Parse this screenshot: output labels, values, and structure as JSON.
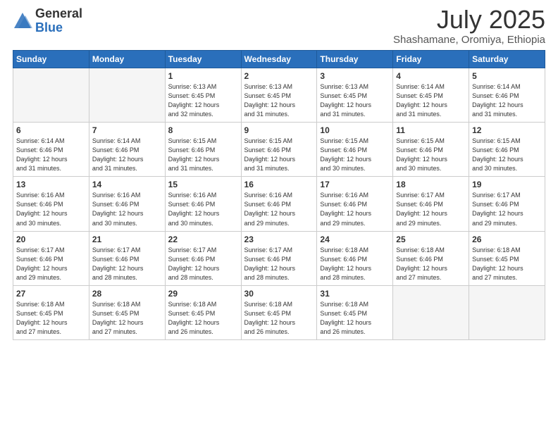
{
  "logo": {
    "general": "General",
    "blue": "Blue"
  },
  "title": {
    "month": "July 2025",
    "location": "Shashamane, Oromiya, Ethiopia"
  },
  "weekdays": [
    "Sunday",
    "Monday",
    "Tuesday",
    "Wednesday",
    "Thursday",
    "Friday",
    "Saturday"
  ],
  "weeks": [
    [
      {
        "day": "",
        "info": ""
      },
      {
        "day": "",
        "info": ""
      },
      {
        "day": "1",
        "info": "Sunrise: 6:13 AM\nSunset: 6:45 PM\nDaylight: 12 hours\nand 32 minutes."
      },
      {
        "day": "2",
        "info": "Sunrise: 6:13 AM\nSunset: 6:45 PM\nDaylight: 12 hours\nand 31 minutes."
      },
      {
        "day": "3",
        "info": "Sunrise: 6:13 AM\nSunset: 6:45 PM\nDaylight: 12 hours\nand 31 minutes."
      },
      {
        "day": "4",
        "info": "Sunrise: 6:14 AM\nSunset: 6:45 PM\nDaylight: 12 hours\nand 31 minutes."
      },
      {
        "day": "5",
        "info": "Sunrise: 6:14 AM\nSunset: 6:46 PM\nDaylight: 12 hours\nand 31 minutes."
      }
    ],
    [
      {
        "day": "6",
        "info": "Sunrise: 6:14 AM\nSunset: 6:46 PM\nDaylight: 12 hours\nand 31 minutes."
      },
      {
        "day": "7",
        "info": "Sunrise: 6:14 AM\nSunset: 6:46 PM\nDaylight: 12 hours\nand 31 minutes."
      },
      {
        "day": "8",
        "info": "Sunrise: 6:15 AM\nSunset: 6:46 PM\nDaylight: 12 hours\nand 31 minutes."
      },
      {
        "day": "9",
        "info": "Sunrise: 6:15 AM\nSunset: 6:46 PM\nDaylight: 12 hours\nand 31 minutes."
      },
      {
        "day": "10",
        "info": "Sunrise: 6:15 AM\nSunset: 6:46 PM\nDaylight: 12 hours\nand 30 minutes."
      },
      {
        "day": "11",
        "info": "Sunrise: 6:15 AM\nSunset: 6:46 PM\nDaylight: 12 hours\nand 30 minutes."
      },
      {
        "day": "12",
        "info": "Sunrise: 6:15 AM\nSunset: 6:46 PM\nDaylight: 12 hours\nand 30 minutes."
      }
    ],
    [
      {
        "day": "13",
        "info": "Sunrise: 6:16 AM\nSunset: 6:46 PM\nDaylight: 12 hours\nand 30 minutes."
      },
      {
        "day": "14",
        "info": "Sunrise: 6:16 AM\nSunset: 6:46 PM\nDaylight: 12 hours\nand 30 minutes."
      },
      {
        "day": "15",
        "info": "Sunrise: 6:16 AM\nSunset: 6:46 PM\nDaylight: 12 hours\nand 30 minutes."
      },
      {
        "day": "16",
        "info": "Sunrise: 6:16 AM\nSunset: 6:46 PM\nDaylight: 12 hours\nand 29 minutes."
      },
      {
        "day": "17",
        "info": "Sunrise: 6:16 AM\nSunset: 6:46 PM\nDaylight: 12 hours\nand 29 minutes."
      },
      {
        "day": "18",
        "info": "Sunrise: 6:17 AM\nSunset: 6:46 PM\nDaylight: 12 hours\nand 29 minutes."
      },
      {
        "day": "19",
        "info": "Sunrise: 6:17 AM\nSunset: 6:46 PM\nDaylight: 12 hours\nand 29 minutes."
      }
    ],
    [
      {
        "day": "20",
        "info": "Sunrise: 6:17 AM\nSunset: 6:46 PM\nDaylight: 12 hours\nand 29 minutes."
      },
      {
        "day": "21",
        "info": "Sunrise: 6:17 AM\nSunset: 6:46 PM\nDaylight: 12 hours\nand 28 minutes."
      },
      {
        "day": "22",
        "info": "Sunrise: 6:17 AM\nSunset: 6:46 PM\nDaylight: 12 hours\nand 28 minutes."
      },
      {
        "day": "23",
        "info": "Sunrise: 6:17 AM\nSunset: 6:46 PM\nDaylight: 12 hours\nand 28 minutes."
      },
      {
        "day": "24",
        "info": "Sunrise: 6:18 AM\nSunset: 6:46 PM\nDaylight: 12 hours\nand 28 minutes."
      },
      {
        "day": "25",
        "info": "Sunrise: 6:18 AM\nSunset: 6:46 PM\nDaylight: 12 hours\nand 27 minutes."
      },
      {
        "day": "26",
        "info": "Sunrise: 6:18 AM\nSunset: 6:45 PM\nDaylight: 12 hours\nand 27 minutes."
      }
    ],
    [
      {
        "day": "27",
        "info": "Sunrise: 6:18 AM\nSunset: 6:45 PM\nDaylight: 12 hours\nand 27 minutes."
      },
      {
        "day": "28",
        "info": "Sunrise: 6:18 AM\nSunset: 6:45 PM\nDaylight: 12 hours\nand 27 minutes."
      },
      {
        "day": "29",
        "info": "Sunrise: 6:18 AM\nSunset: 6:45 PM\nDaylight: 12 hours\nand 26 minutes."
      },
      {
        "day": "30",
        "info": "Sunrise: 6:18 AM\nSunset: 6:45 PM\nDaylight: 12 hours\nand 26 minutes."
      },
      {
        "day": "31",
        "info": "Sunrise: 6:18 AM\nSunset: 6:45 PM\nDaylight: 12 hours\nand 26 minutes."
      },
      {
        "day": "",
        "info": ""
      },
      {
        "day": "",
        "info": ""
      }
    ]
  ]
}
